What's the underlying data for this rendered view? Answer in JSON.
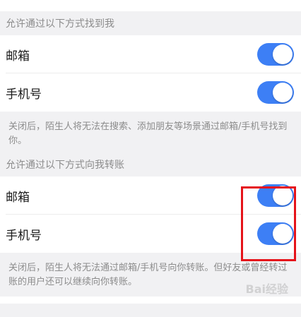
{
  "section1": {
    "header": "允许通过以下方式找到我",
    "items": [
      {
        "label": "邮箱",
        "on": true
      },
      {
        "label": "手机号",
        "on": true
      }
    ],
    "note": "关闭后，陌生人将无法在搜索、添加朋友等场景通过邮箱/手机号找到你。"
  },
  "section2": {
    "header": "允许通过以下方式向我转账",
    "items": [
      {
        "label": "邮箱",
        "on": true
      },
      {
        "label": "手机号",
        "on": true
      }
    ],
    "note": "关闭后，陌生人将无法通过邮箱/手机号向你转账。但好友或曾经转过账的用户还可以继续向你转账。"
  },
  "watermark": "Bai经验",
  "colors": {
    "toggle_on": "#3d7ff5",
    "highlight": "#e5131a"
  }
}
